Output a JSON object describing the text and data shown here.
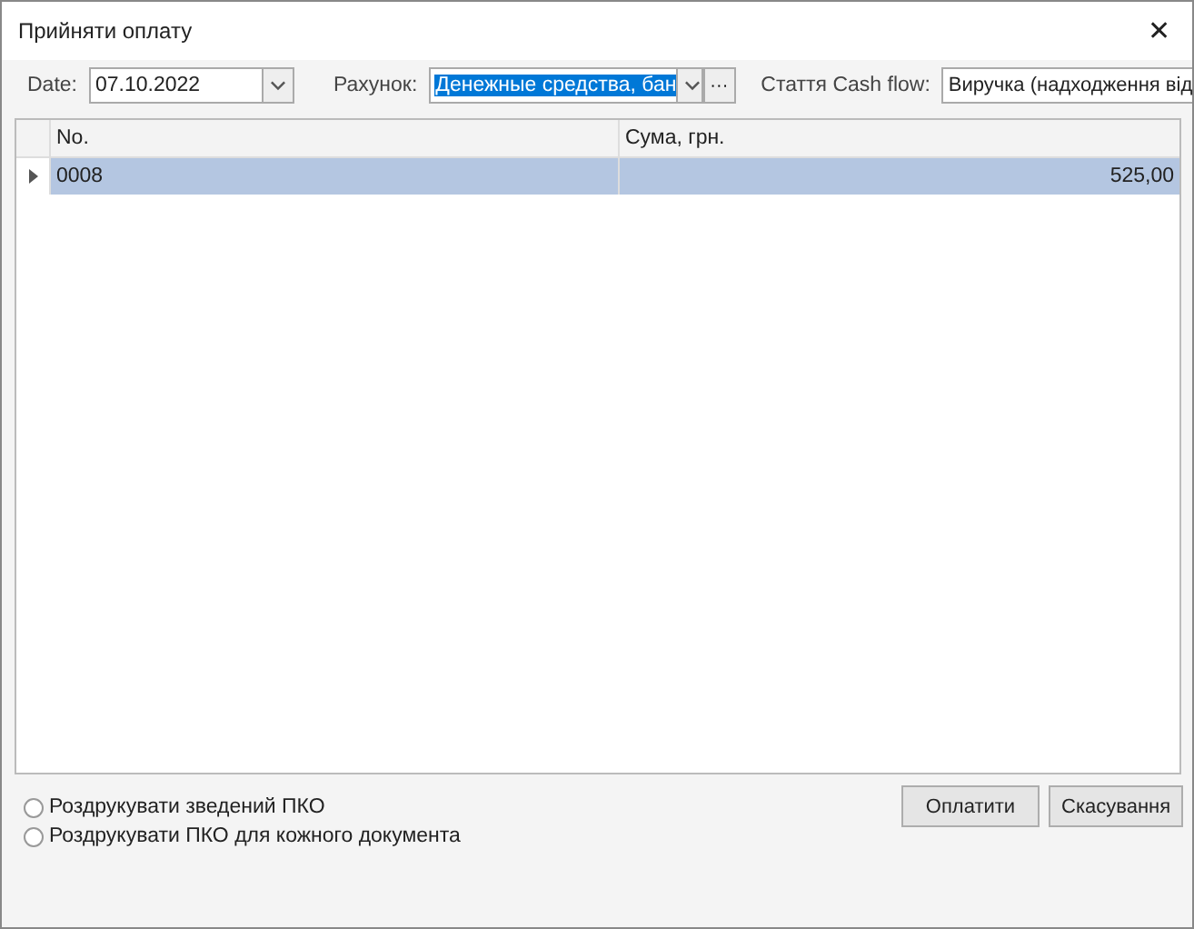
{
  "window": {
    "title": "Прийняти оплату",
    "close": "✕"
  },
  "filters": {
    "date": {
      "label": "Date:",
      "value": "07.10.2022"
    },
    "account": {
      "label": "Рахунок:",
      "value": "Денежные средства, бан",
      "text_selected": true,
      "more": "···"
    },
    "cash_flow": {
      "label": "Стаття Cash flow:",
      "value": "Виручка (надходження від"
    }
  },
  "table": {
    "columns": [
      "No.",
      "Сума, грн."
    ],
    "rows": [
      {
        "cells": [
          "0008",
          "525,00"
        ],
        "selected": true
      }
    ]
  },
  "options": [
    {
      "label": "Роздрукувати зведений ПКО",
      "checked": false
    },
    {
      "label": "Роздрукувати ПКО для кожного документа",
      "checked": false
    }
  ],
  "buttons": [
    "Оплатити",
    "Скасування"
  ]
}
